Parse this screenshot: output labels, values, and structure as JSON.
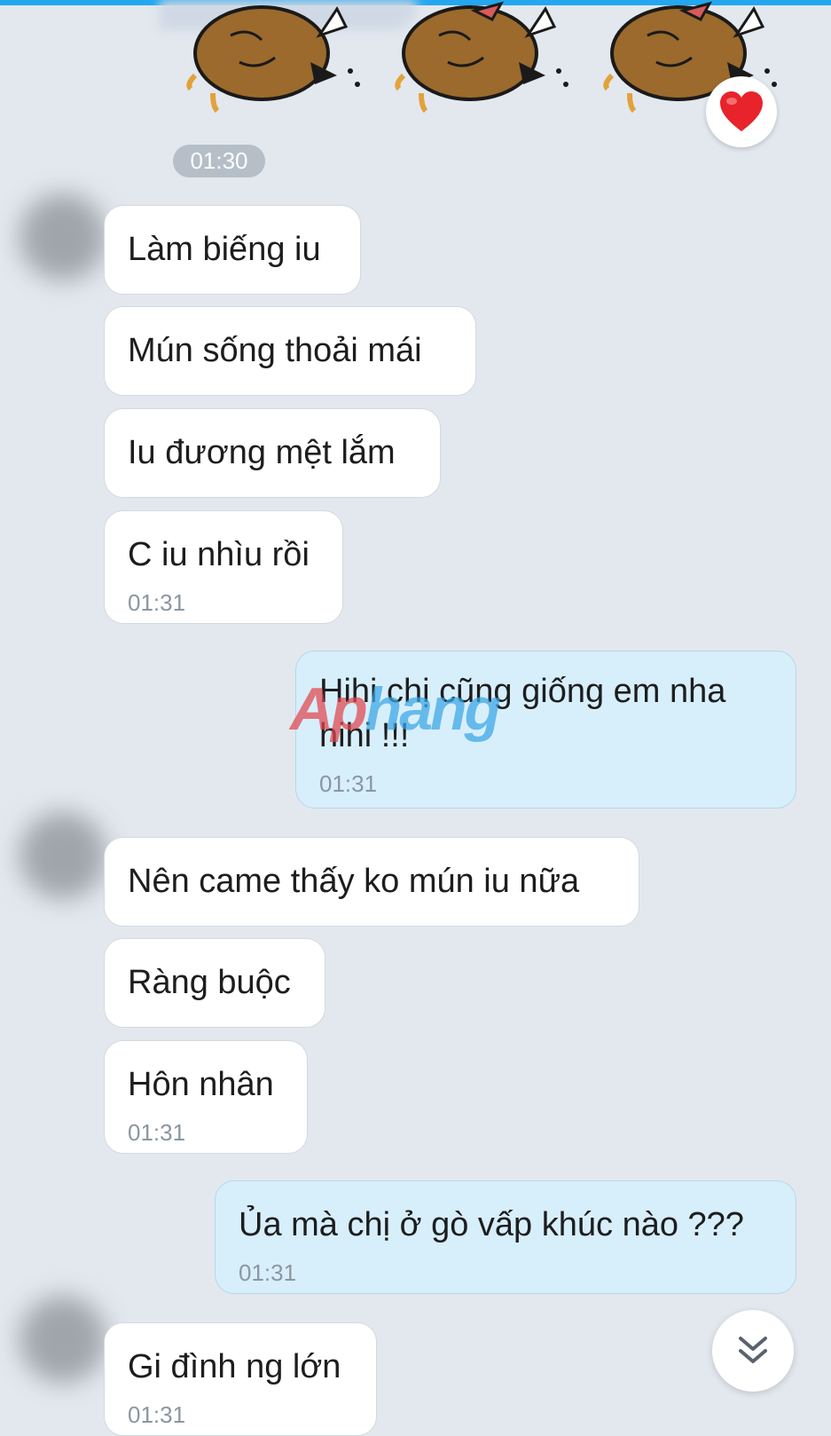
{
  "time_divider": "01:30",
  "reaction": {
    "icon": "heart-icon",
    "color": "#e8232b"
  },
  "messages": [
    {
      "text": "Làm biếng iu",
      "time": ""
    },
    {
      "text": "Mún sống thoải mái",
      "time": ""
    },
    {
      "text": "Iu đương mệt lắm",
      "time": ""
    },
    {
      "text": "C iu nhìu rồi",
      "time": "01:31"
    },
    {
      "text": "Hihi chị cũng giống em nha hihi !!!",
      "time": "01:31"
    },
    {
      "text": "Nên came thấy ko mún iu nữa",
      "time": ""
    },
    {
      "text": "Ràng buộc",
      "time": ""
    },
    {
      "text": "Hôn nhân",
      "time": "01:31"
    },
    {
      "text": "Ủa mà chị ở gò vấp khúc nào ???",
      "time": "01:31"
    },
    {
      "text": "Gi đình ng lớn",
      "time": "01:31"
    }
  ],
  "watermark": {
    "part1": "Ap",
    "part2": "hang"
  },
  "scroll_button": {
    "icon": "double-chevron-down-icon"
  },
  "colors": {
    "accent": "#22a7f0",
    "outgoing_bubble": "#d7effb",
    "background": "#e3e8ef"
  }
}
